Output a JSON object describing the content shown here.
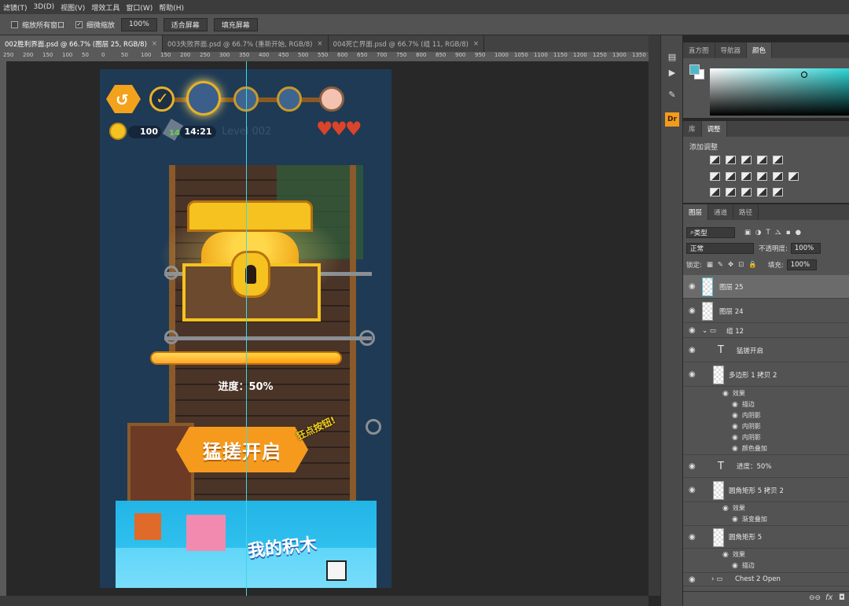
{
  "menu": [
    "滤镜(T)",
    "3D(D)",
    "视图(V)",
    "增效工具",
    "窗口(W)",
    "帮助(H)"
  ],
  "options": {
    "resize_windows_label": "缩放所有窗口",
    "scrubby_zoom_label": "细微缩放",
    "scrubby_zoom_checked": true,
    "zoom_value": "100%",
    "fit_screen_label": "适合屏幕",
    "fill_screen_label": "填充屏幕"
  },
  "tabs": [
    {
      "label": "002胜利界面.psd @ 66.7% (图层 25, RGB/8)",
      "active": true
    },
    {
      "label": "003失败界面.psd @ 66.7% (重新开始, RGB/8)",
      "active": false
    },
    {
      "label": "004死亡界面.psd @ 66.7% (组 11, RGB/8)",
      "active": false
    }
  ],
  "ruler_ticks": [
    "250",
    "200",
    "150",
    "100",
    "50",
    "0",
    "50",
    "100",
    "150",
    "200",
    "250",
    "300",
    "350",
    "400",
    "450",
    "500",
    "550",
    "600",
    "650",
    "700",
    "750",
    "800",
    "850",
    "900",
    "950",
    "1000",
    "1050",
    "1100",
    "1150",
    "1200",
    "1250",
    "1300",
    "1350"
  ],
  "game": {
    "coins": "100",
    "timer": "14:21",
    "timer_badge": "14",
    "level": "Level 002",
    "progress_label": "进度：50%",
    "progress_value": 0.5,
    "start_button": "猛搓开启",
    "start_badge": "狂点按钮!",
    "banner_text": "我的积木"
  },
  "color_panel": {
    "tabs": [
      "直方图",
      "导航器",
      "颜色"
    ],
    "active": "颜色",
    "fg_color": "#4fb8c8",
    "bg_color": "#ffffff"
  },
  "adjust_panel": {
    "tabs": [
      "库",
      "调整"
    ],
    "active": "调整",
    "title": "添加调整"
  },
  "layers_panel": {
    "tabs": [
      "图层",
      "通道",
      "路径"
    ],
    "active": "图层",
    "filter_kind": "类型",
    "blend_mode": "正常",
    "opacity_label": "不透明度:",
    "opacity": "100%",
    "lock_label": "锁定:",
    "fill_label": "填充:",
    "fill": "100%",
    "layers": [
      {
        "name": "图层 25"
      },
      {
        "name": "图层 24"
      },
      {
        "name": "组 12"
      },
      {
        "name": "猛搓开启"
      },
      {
        "name": "多边形 1 拷贝 2"
      },
      {
        "name": "效果"
      },
      {
        "name": "描边"
      },
      {
        "name": "内阴影"
      },
      {
        "name": "内阴影"
      },
      {
        "name": "内阴影"
      },
      {
        "name": "颜色叠加"
      },
      {
        "name": "进度：50%"
      },
      {
        "name": "圆角矩形 5 拷贝 2"
      },
      {
        "name": "效果"
      },
      {
        "name": "渐变叠加"
      },
      {
        "name": "圆角矩形 5"
      },
      {
        "name": "效果"
      },
      {
        "name": "描边"
      },
      {
        "name": "Chest 2 Open"
      }
    ],
    "footer": "fx"
  }
}
